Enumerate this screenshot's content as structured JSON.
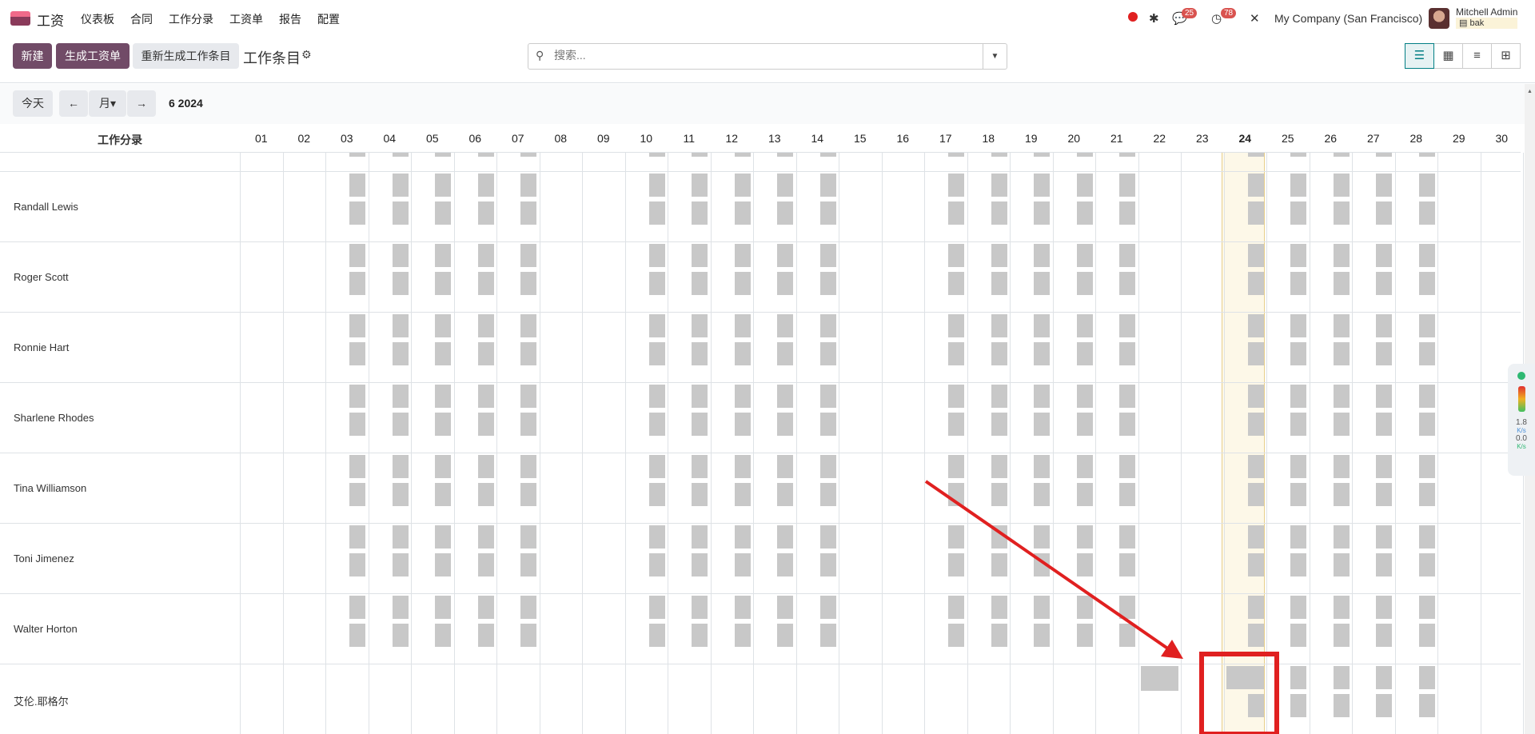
{
  "app": {
    "name": "工资"
  },
  "menu": [
    "仪表板",
    "合同",
    "工作分录",
    "工资单",
    "报告",
    "配置"
  ],
  "systray": {
    "messages_count": "25",
    "activities_count": "78",
    "company": "My Company (San Francisco)",
    "user_name": "Mitchell Admin",
    "db_name": "bak"
  },
  "control": {
    "new_label": "新建",
    "generate_payslips_label": "生成工资单",
    "regenerate_label": "重新生成工作条目",
    "page_title": "工作条目"
  },
  "search": {
    "placeholder": "搜索..."
  },
  "nav": {
    "today_label": "今天",
    "scale_label": "月",
    "range_label": "6 2024"
  },
  "gantt": {
    "header_title": "工作分录",
    "days": [
      "01",
      "02",
      "03",
      "04",
      "05",
      "06",
      "07",
      "08",
      "09",
      "10",
      "11",
      "12",
      "13",
      "14",
      "15",
      "16",
      "17",
      "18",
      "19",
      "20",
      "21",
      "22",
      "23",
      "24",
      "25",
      "26",
      "27",
      "28",
      "29",
      "30"
    ],
    "today": "24",
    "rows": [
      {
        "name": "Randall Lewis",
        "entries": "weekday"
      },
      {
        "name": "Roger Scott",
        "entries": "weekday"
      },
      {
        "name": "Ronnie Hart",
        "entries": "weekday"
      },
      {
        "name": "Sharlene Rhodes",
        "entries": "weekday"
      },
      {
        "name": "Tina Williamson",
        "entries": "weekday"
      },
      {
        "name": "Toni Jimenez",
        "entries": "weekday"
      },
      {
        "name": "Walter Horton",
        "entries": "weekday"
      },
      {
        "name": "艾伦.耶格尔",
        "entries": "from-22"
      }
    ]
  },
  "widget": {
    "up_speed": "1.8",
    "up_unit": "K/s",
    "down_speed": "0.0",
    "down_unit": "K/s"
  },
  "colors": {
    "primary": "#714b67",
    "entry_gray": "#c8c8c8",
    "today_bg": "#fdf8e8",
    "annotation_red": "#e02020"
  }
}
